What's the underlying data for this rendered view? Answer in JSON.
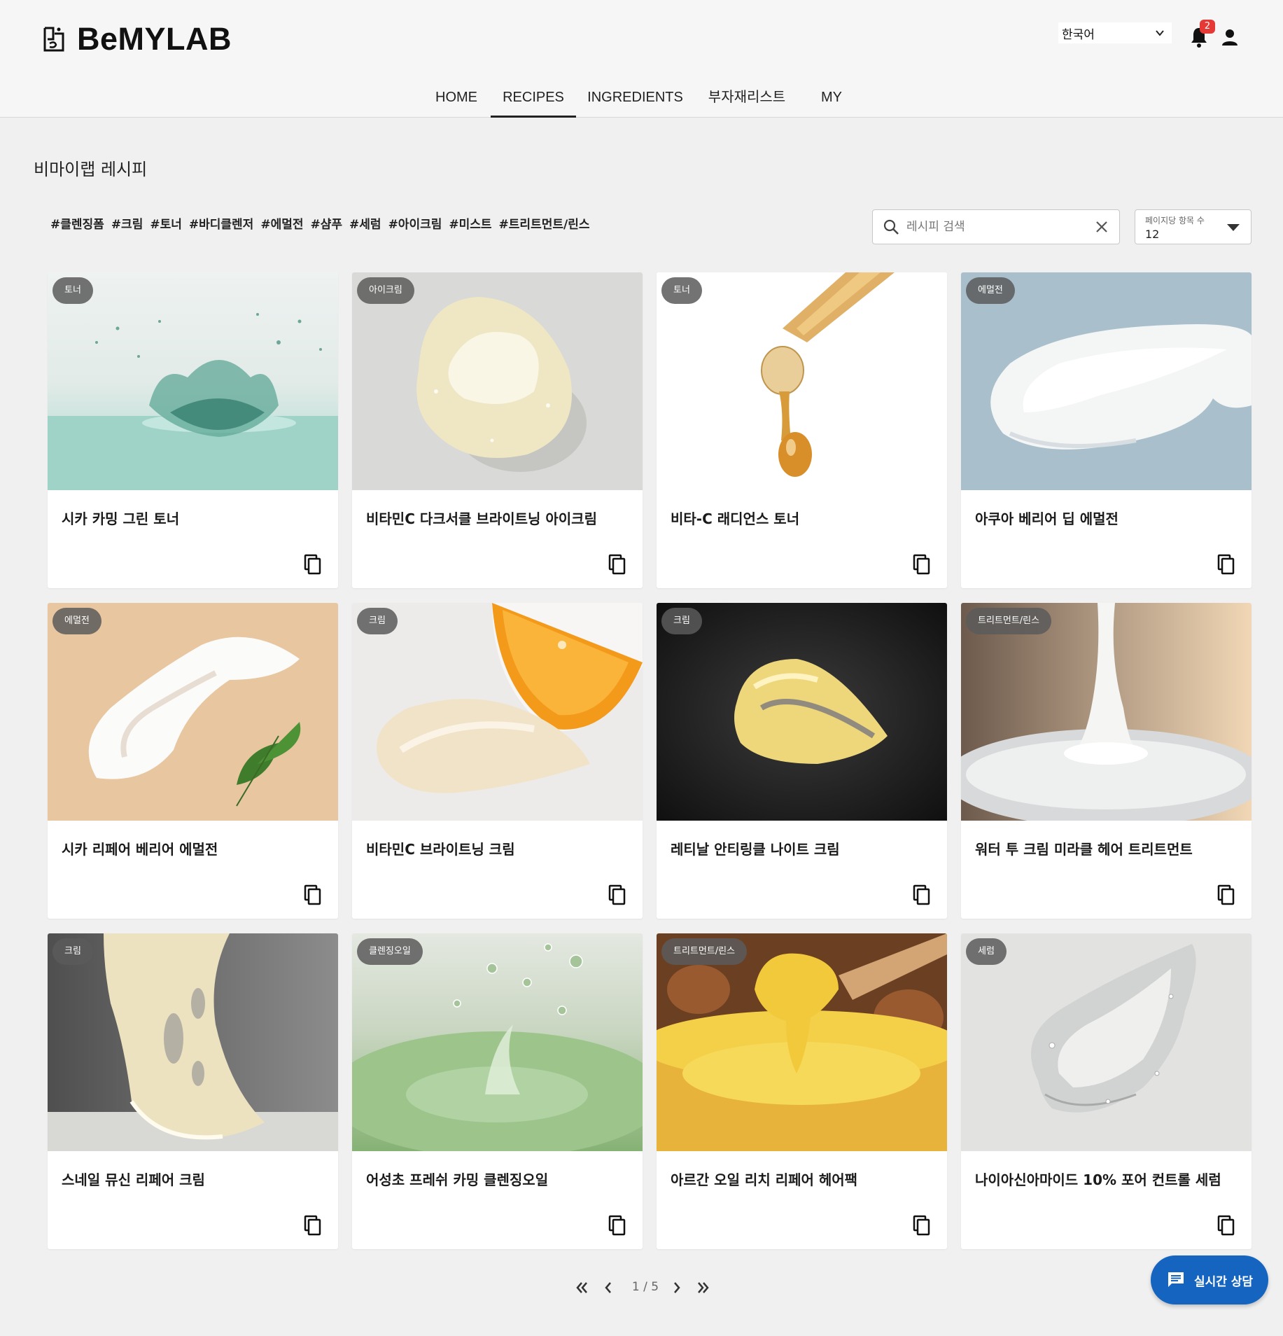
{
  "header": {
    "logo_text": "BeMYLAB",
    "language": "한국어",
    "notification_count": "2"
  },
  "nav": [
    {
      "label": "HOME"
    },
    {
      "label": "RECIPES",
      "active": true
    },
    {
      "label": "INGREDIENTS"
    },
    {
      "label": "부자재리스트"
    },
    {
      "label": "MY"
    }
  ],
  "page_title": "비마이랩 레시피",
  "tags": [
    "#클렌징폼",
    "#크림",
    "#토너",
    "#바디클렌저",
    "#에멀전",
    "#샴푸",
    "#세럼",
    "#아이크림",
    "#미스트",
    "#트리트먼트/린스"
  ],
  "search": {
    "placeholder": "레시피 검색",
    "value": ""
  },
  "per_page": {
    "label": "페이지당 항목 수",
    "value": "12"
  },
  "cards": [
    {
      "category": "토너",
      "title": "시카 카밍 그린 토너",
      "image": "water-splash"
    },
    {
      "category": "아이크림",
      "title": "비타민C 다크서클 브라이트닝 아이크림",
      "image": "gel-blob"
    },
    {
      "category": "토너",
      "title": "비타-C 래디언스 토너",
      "image": "dropper"
    },
    {
      "category": "에멀전",
      "title": "아쿠아 베리어 딥 에멀전",
      "image": "cream-swipe-blue"
    },
    {
      "category": "에멀전",
      "title": "시카 리페어 베리어 에멀전",
      "image": "cream-leaf"
    },
    {
      "category": "크림",
      "title": "비타민C 브라이트닝 크림",
      "image": "cream-orange"
    },
    {
      "category": "크림",
      "title": "레티날 안티링클 나이트 크림",
      "image": "yellow-cream-dark"
    },
    {
      "category": "트리트먼트/린스",
      "title": "워터 투 크림 미라클 헤어 트리트먼트",
      "image": "milk-pour"
    },
    {
      "category": "크림",
      "title": "스네일 뮤신 리페어 크림",
      "image": "snail-mucin"
    },
    {
      "category": "클렌징오일",
      "title": "어성초 프레쉬 카밍 클렌징오일",
      "image": "green-splash"
    },
    {
      "category": "트리트먼트/린스",
      "title": "아르간 오일 리치 리페어 헤어팩",
      "image": "honey-jar"
    },
    {
      "category": "세럼",
      "title": "나이아신아마이드 10% 포어 컨트롤 세럼",
      "image": "clear-gel"
    }
  ],
  "pagination": {
    "current": "1",
    "separator": "/",
    "total": "5",
    "text": "1 / 5"
  },
  "chat_button": {
    "label": "실시간 상담"
  },
  "colors": {
    "accent": "#1565c0",
    "badge": "#e53935",
    "background": "#f0f0f0"
  }
}
